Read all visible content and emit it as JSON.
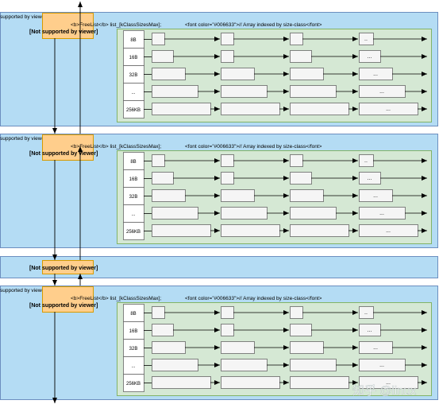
{
  "panels": [
    {
      "corner_label": "supported by viewer]",
      "node_label": "[Not supported by viewer]",
      "freelist_title": "<b>FreeList</b> list_[kClassSizesMax];",
      "freelist_comment": "<font color=\"#006633\">// Array indexed by size-class</font>",
      "rows": [
        {
          "label": "8B",
          "ellipsis": ".."
        },
        {
          "label": "16B",
          "ellipsis": "..."
        },
        {
          "label": "32B",
          "ellipsis": "..."
        },
        {
          "label": "...",
          "ellipsis": "..."
        },
        {
          "label": "256KB",
          "ellipsis": "..."
        }
      ]
    },
    {
      "corner_label": "supported by viewer]",
      "node_label": "[Not supported by viewer]",
      "freelist_title": "<b>FreeList</b> list_[kClassSizesMax];",
      "freelist_comment": "<font color=\"#006633\">// Array indexed by size-class</font>",
      "rows": [
        {
          "label": "8B",
          "ellipsis": ".."
        },
        {
          "label": "16B",
          "ellipsis": "..."
        },
        {
          "label": "32B",
          "ellipsis": "..."
        },
        {
          "label": "...",
          "ellipsis": "..."
        },
        {
          "label": "256KB",
          "ellipsis": "..."
        }
      ]
    },
    {
      "corner_label": "supported by viewer]",
      "node_label": "[Not supported by viewer]",
      "freelist_title": "<b>FreeList</b> list_[kClassSizesMax];",
      "freelist_comment": "<font color=\"#006633\">// Array indexed by size-class</font>",
      "rows": [
        {
          "label": "8B",
          "ellipsis": ".."
        },
        {
          "label": "16B",
          "ellipsis": "..."
        },
        {
          "label": "32B",
          "ellipsis": "..."
        },
        {
          "label": "...",
          "ellipsis": "..."
        },
        {
          "label": "256KB",
          "ellipsis": "..."
        }
      ]
    }
  ],
  "middle_bar": {
    "node_label": "[Not supported by viewer]"
  },
  "watermark": "知乎 @linux",
  "colors": {
    "panel_fill": "#b4dcf4",
    "panel_stroke": "#6c8ebf",
    "node_fill": "#ffce8c",
    "node_stroke": "#d79b00",
    "freelist_fill": "#d5e8d4",
    "freelist_stroke": "#82b366",
    "cell_fill": "#f5f5f5",
    "cell_stroke": "#666666",
    "line": "#000000"
  }
}
